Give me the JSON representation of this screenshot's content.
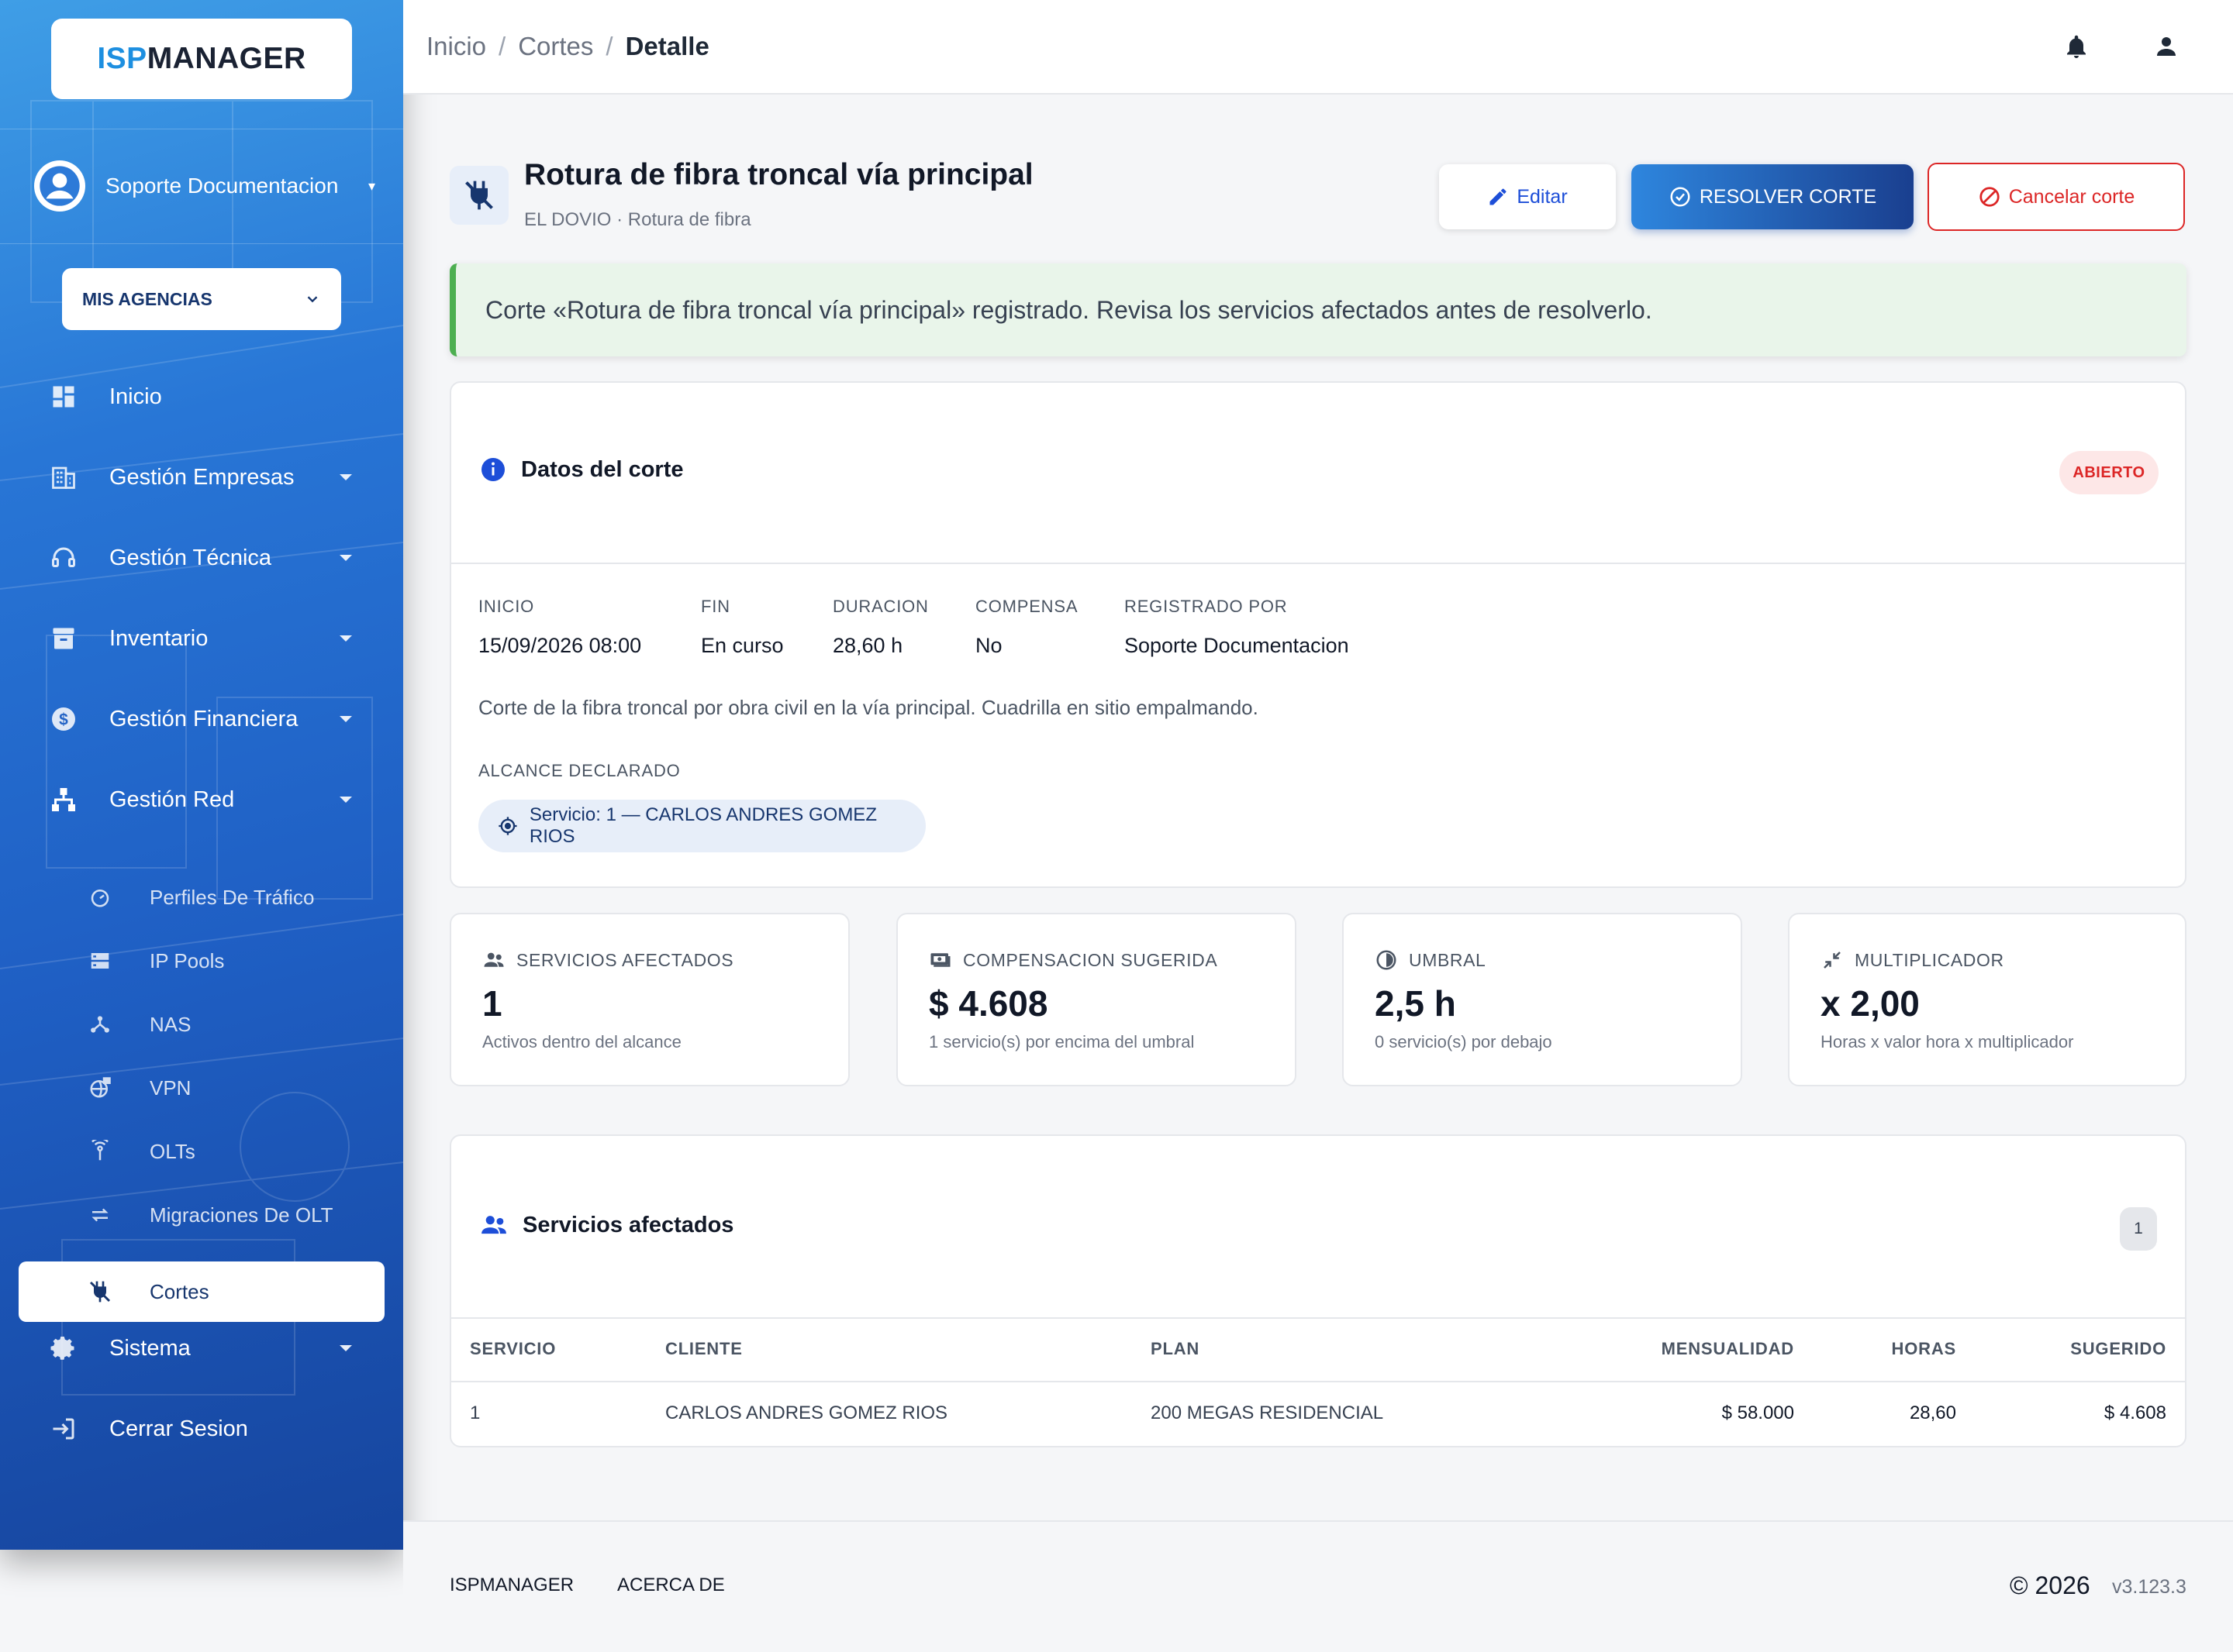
{
  "app": {
    "logo_part1": "ISP",
    "logo_part2": "MANAGER"
  },
  "sidebar": {
    "user_name": "Soporte Documentacion",
    "agency_select": "MIS AGENCIAS",
    "nav": [
      {
        "label": "Inicio",
        "icon": "dashboard-icon"
      },
      {
        "label": "Gestión Empresas",
        "icon": "building-icon"
      },
      {
        "label": "Gestión Técnica",
        "icon": "support-agent-icon"
      },
      {
        "label": "Inventario",
        "icon": "archive-icon"
      },
      {
        "label": "Gestión Financiera",
        "icon": "dollar-icon"
      },
      {
        "label": "Gestión Red",
        "icon": "network-icon"
      }
    ],
    "subnav": [
      {
        "label": "Perfiles De Tráfico",
        "icon": "speedometer-icon"
      },
      {
        "label": "IP Pools",
        "icon": "server-icon"
      },
      {
        "label": "NAS",
        "icon": "hub-icon"
      },
      {
        "label": "VPN",
        "icon": "globe-lock-icon"
      },
      {
        "label": "OLTs",
        "icon": "antenna-icon"
      },
      {
        "label": "Migraciones De OLT",
        "icon": "swap-icon"
      },
      {
        "label": "Cortes",
        "icon": "power-off-icon"
      }
    ],
    "system": "Sistema",
    "logout": "Cerrar Sesion"
  },
  "topbar": {
    "breadcrumb": [
      "Inicio",
      "Cortes",
      "Detalle"
    ],
    "separator": "/"
  },
  "header": {
    "title": "Rotura de fibra troncal vía principal",
    "subtitle": "EL DOVIO · Rotura de fibra",
    "edit": "Editar",
    "resolve": "RESOLVER CORTE",
    "cancel": "Cancelar corte"
  },
  "alert": "Corte «Rotura de fibra troncal vía principal» registrado. Revisa los servicios afectados antes de resolverlo.",
  "details": {
    "title": "Datos del corte",
    "status": "ABIERTO",
    "fields": [
      {
        "label": "INICIO",
        "value": "15/09/2026 08:00"
      },
      {
        "label": "FIN",
        "value": "En curso"
      },
      {
        "label": "DURACION",
        "value": "28,60 h"
      },
      {
        "label": "COMPENSA",
        "value": "No"
      },
      {
        "label": "REGISTRADO POR",
        "value": "Soporte Documentacion"
      }
    ],
    "description": "Corte de la fibra troncal por obra civil en la vía principal. Cuadrilla en sitio empalmando.",
    "scope_label": "ALCANCE DECLARADO",
    "scope_chip": "Servicio: 1 — CARLOS ANDRES GOMEZ RIOS"
  },
  "stats": [
    {
      "label": "SERVICIOS AFECTADOS",
      "value": "1",
      "hint": "Activos dentro del alcance",
      "icon": "people-icon"
    },
    {
      "label": "COMPENSACION SUGERIDA",
      "value": "$ 4.608",
      "hint": "1 servicio(s) por encima del umbral",
      "icon": "cash-icon"
    },
    {
      "label": "UMBRAL",
      "value": "2,5 h",
      "hint": "0 servicio(s) por debajo",
      "icon": "threshold-icon"
    },
    {
      "label": "MULTIPLICADOR",
      "value": "x 2,00",
      "hint": "Horas x valor hora x multiplicador",
      "icon": "compress-icon"
    }
  ],
  "services": {
    "title": "Servicios afectados",
    "count": "1",
    "columns": [
      "SERVICIO",
      "CLIENTE",
      "PLAN",
      "MENSUALIDAD",
      "HORAS",
      "SUGERIDO"
    ],
    "rows": [
      [
        "1",
        "CARLOS ANDRES GOMEZ RIOS",
        "200 MEGAS RESIDENCIAL",
        "$ 58.000",
        "28,60",
        "$ 4.608"
      ]
    ]
  },
  "footer": {
    "link1": "ISPMANAGER",
    "link2": "ACERCA DE",
    "copyright": "© 2026",
    "version": "v3.123.3"
  }
}
